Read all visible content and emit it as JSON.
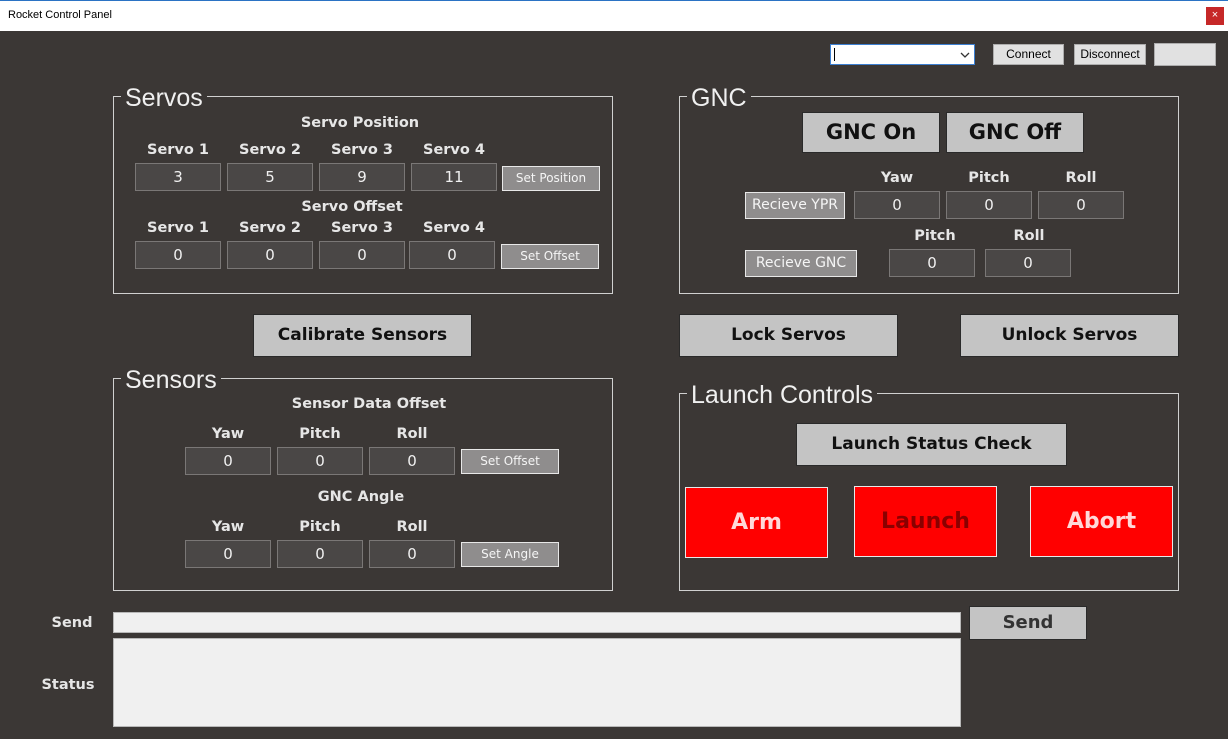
{
  "window": {
    "title": "Rocket Control Panel",
    "close_glyph": "×"
  },
  "connection": {
    "port_value": "",
    "connect_label": "Connect",
    "disconnect_label": "Disconnect",
    "status_box": ""
  },
  "servos": {
    "title": "Servos",
    "position_heading": "Servo Position",
    "position_labels": [
      "Servo 1",
      "Servo 2",
      "Servo 3",
      "Servo 4"
    ],
    "position_values": [
      "3",
      "5",
      "9",
      "11"
    ],
    "set_position_label": "Set Position",
    "offset_heading": "Servo Offset",
    "offset_labels": [
      "Servo 1",
      "Servo 2",
      "Servo 3",
      "Servo 4"
    ],
    "offset_values": [
      "0",
      "0",
      "0",
      "0"
    ],
    "set_offset_label": "Set Offset"
  },
  "gnc": {
    "title": "GNC",
    "on_label": "GNC On",
    "off_label": "GNC Off",
    "ypr_labels": [
      "Yaw",
      "Pitch",
      "Roll"
    ],
    "ypr_values": [
      "0",
      "0",
      "0"
    ],
    "receive_ypr_label": "Recieve YPR",
    "gnc_labels": [
      "Pitch",
      "Roll"
    ],
    "gnc_values": [
      "0",
      "0"
    ],
    "receive_gnc_label": "Recieve GNC"
  },
  "calibrate_label": "Calibrate Sensors",
  "lock_servos_label": "Lock Servos",
  "unlock_servos_label": "Unlock Servos",
  "sensors": {
    "title": "Sensors",
    "offset_heading": "Sensor Data Offset",
    "offset_labels": [
      "Yaw",
      "Pitch",
      "Roll"
    ],
    "offset_values": [
      "0",
      "0",
      "0"
    ],
    "set_offset_label": "Set Offset",
    "angle_heading": "GNC Angle",
    "angle_labels": [
      "Yaw",
      "Pitch",
      "Roll"
    ],
    "angle_values": [
      "0",
      "0",
      "0"
    ],
    "set_angle_label": "Set Angle"
  },
  "launch": {
    "title": "Launch Controls",
    "status_check_label": "Launch Status Check",
    "arm_label": "Arm",
    "launch_label": "Launch",
    "abort_label": "Abort",
    "arm_text_color": "#ffd8d8",
    "launch_text_color": "#8a0000",
    "abort_text_color": "#ffd8d8",
    "button_color": "#ff0000"
  },
  "console": {
    "send_label": "Send",
    "send_value": "",
    "send_button_label": "Send",
    "status_label": "Status",
    "status_value": ""
  }
}
